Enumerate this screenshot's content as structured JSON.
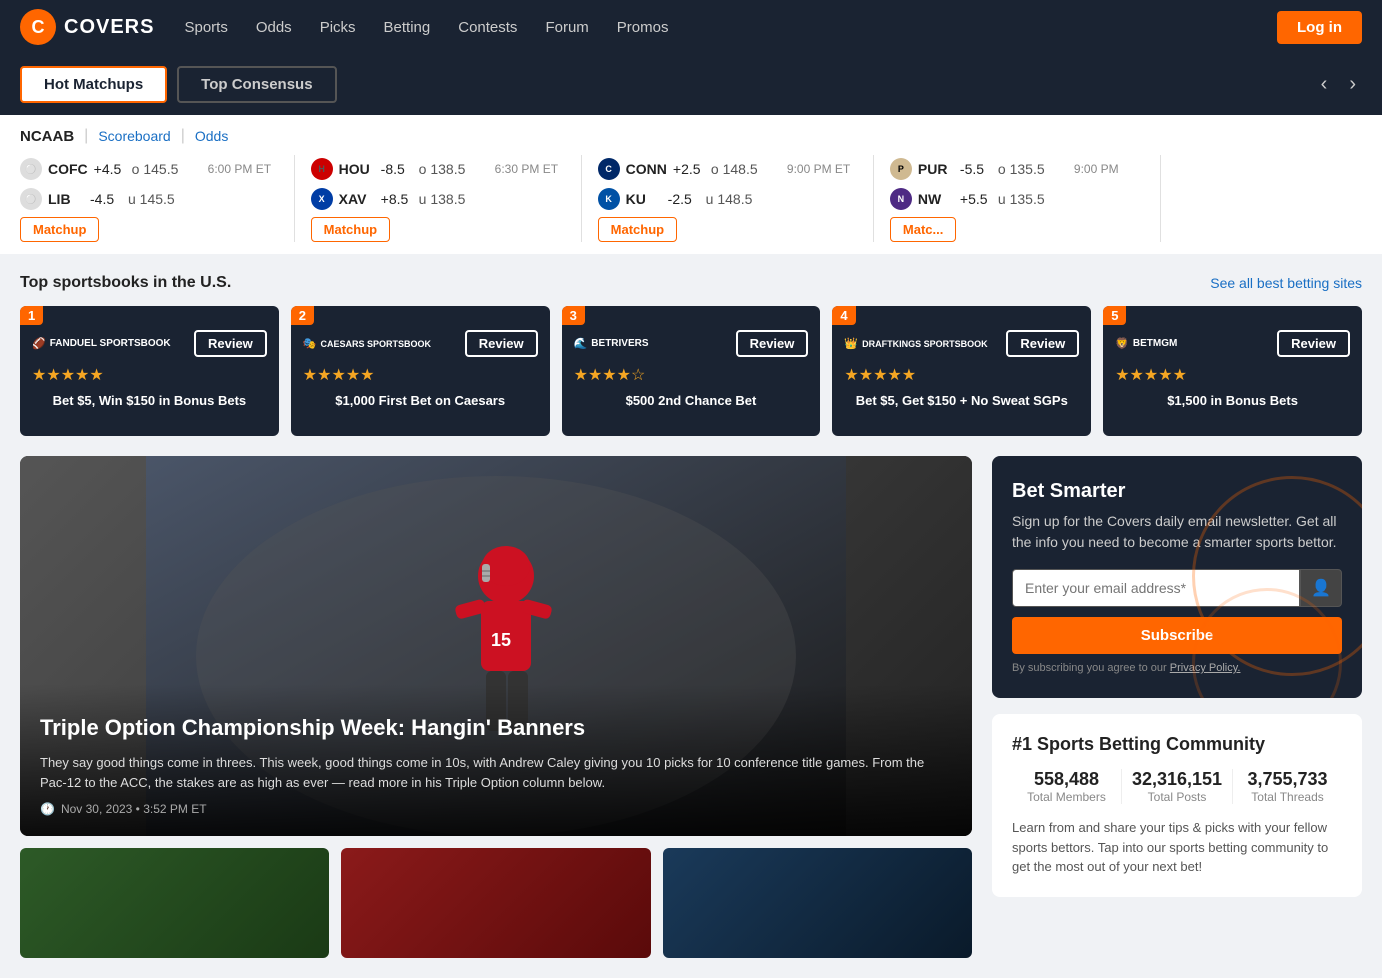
{
  "header": {
    "logo_text": "COVERS",
    "nav_items": [
      "Sports",
      "Odds",
      "Picks",
      "Betting",
      "Contests",
      "Forum",
      "Promos"
    ],
    "login_label": "Log in"
  },
  "tabs": {
    "active": "Hot Matchups",
    "inactive": "Top Consensus"
  },
  "scoreboard": {
    "league": "NCAAB",
    "links": [
      "Scoreboard",
      "Odds"
    ],
    "matchups": [
      {
        "teams": [
          {
            "abbr": "COFC",
            "spread": "+4.5",
            "ou": "o 145.5",
            "time": "6:00 PM ET"
          },
          {
            "abbr": "LIB",
            "spread": "-4.5",
            "ou": "u 145.5",
            "time": ""
          }
        ],
        "btn": "Matchup"
      },
      {
        "teams": [
          {
            "abbr": "HOU",
            "spread": "-8.5",
            "ou": "o 138.5",
            "time": "6:30 PM ET"
          },
          {
            "abbr": "XAV",
            "spread": "+8.5",
            "ou": "u 138.5",
            "time": ""
          }
        ],
        "btn": "Matchup"
      },
      {
        "teams": [
          {
            "abbr": "CONN",
            "spread": "+2.5",
            "ou": "o 148.5",
            "time": "9:00 PM ET"
          },
          {
            "abbr": "KU",
            "spread": "-2.5",
            "ou": "u 148.5",
            "time": ""
          }
        ],
        "btn": "Matchup"
      },
      {
        "teams": [
          {
            "abbr": "PUR",
            "spread": "-5.5",
            "ou": "o 135.5",
            "time": "9:00 PM"
          },
          {
            "abbr": "NW",
            "spread": "+5.5",
            "ou": "u 135.5",
            "time": ""
          }
        ],
        "btn": "Matc..."
      }
    ]
  },
  "sportsbooks": {
    "title": "Top sportsbooks in the U.S.",
    "see_all": "See all best betting sites",
    "items": [
      {
        "rank": "1",
        "name": "FANDUEL SPORTSBOOK",
        "stars": "★★★★★",
        "promo": "Bet $5, Win $150 in Bonus Bets",
        "review": "Review"
      },
      {
        "rank": "2",
        "name": "CAESARS SPORTSBOOK",
        "stars": "★★★★★",
        "promo": "$1,000 First Bet on Caesars",
        "review": "Review"
      },
      {
        "rank": "3",
        "name": "BETRIVERS",
        "stars": "★★★★☆",
        "promo": "$500 2nd Chance Bet",
        "review": "Review"
      },
      {
        "rank": "4",
        "name": "DRAFTKINGS SPORTSBOOK",
        "stars": "★★★★★",
        "promo": "Bet $5, Get $150 + No Sweat SGPs",
        "review": "Review"
      },
      {
        "rank": "5",
        "name": "BETMGM",
        "stars": "★★★★★",
        "promo": "$1,500 in Bonus Bets",
        "review": "Review"
      }
    ]
  },
  "featured_article": {
    "title": "Triple Option Championship Week: Hangin' Banners",
    "excerpt": "They say good things come in threes. This week, good things come in 10s, with Andrew Caley giving you 10 picks for 10 conference title games. From the Pac-12 to the ACC, the stakes are as high as ever — read more in his Triple Option column below.",
    "date": "Nov 30, 2023 • 3:52 PM ET"
  },
  "newsletter": {
    "title": "Bet Smarter",
    "description": "Sign up for the Covers daily email newsletter. Get all the info you need to become a smarter sports bettor.",
    "placeholder": "Enter your email address*",
    "subscribe_label": "Subscribe",
    "terms": "By subscribing you agree to our",
    "privacy_link": "Privacy Policy."
  },
  "community": {
    "title": "#1 Sports Betting Community",
    "stats": [
      {
        "number": "558,488",
        "label": "Total Members"
      },
      {
        "number": "32,316,151",
        "label": "Total Posts"
      },
      {
        "number": "3,755,733",
        "label": "Total Threads"
      }
    ],
    "description": "Learn from and share your tips & picks with your fellow sports bettors. Tap into our sports betting community to get the most out of your next bet!"
  }
}
